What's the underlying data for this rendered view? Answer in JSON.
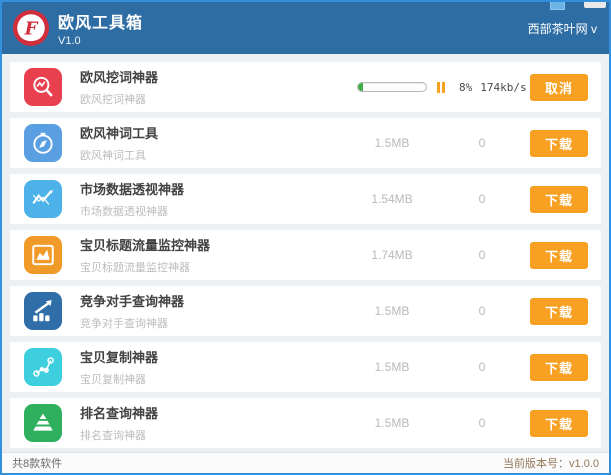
{
  "header": {
    "title": "欧风工具箱",
    "version": "V1.0",
    "right_text": "西部茶叶网 v"
  },
  "rows": [
    {
      "icon": "keyword-mining-icon",
      "icon_color": "#e8404e",
      "title": "欧风挖词神器",
      "subtitle": "欧风挖词神器",
      "state": "downloading",
      "progress": 8,
      "progress_label": "8%",
      "speed": "174kb/s",
      "button_label": "取消"
    },
    {
      "icon": "compass-icon",
      "icon_color": "#5b9fe3",
      "title": "欧风神词工具",
      "subtitle": "欧风神词工具",
      "state": "idle",
      "size": "1.5MB",
      "count": "0",
      "button_label": "下载"
    },
    {
      "icon": "line-chart-icon",
      "icon_color": "#4cb2e9",
      "title": "市场数据透视神器",
      "subtitle": "市场数据透视神器",
      "state": "idle",
      "size": "1.54MB",
      "count": "0",
      "button_label": "下载"
    },
    {
      "icon": "chart-box-icon",
      "icon_color": "#f09b28",
      "title": "宝贝标题流量监控神器",
      "subtitle": "宝贝标题流量监控神器",
      "state": "idle",
      "size": "1.74MB",
      "count": "0",
      "button_label": "下载"
    },
    {
      "icon": "trend-coins-icon",
      "icon_color": "#2f6ea8",
      "title": "竞争对手查询神器",
      "subtitle": "竞争对手查询神器",
      "state": "idle",
      "size": "1.5MB",
      "count": "0",
      "button_label": "下载"
    },
    {
      "icon": "nodes-icon",
      "icon_color": "#3ecfdf",
      "title": "宝贝复制神器",
      "subtitle": "宝贝复制神器",
      "state": "idle",
      "size": "1.5MB",
      "count": "0",
      "button_label": "下载"
    },
    {
      "icon": "pyramid-icon",
      "icon_color": "#2fb05e",
      "title": "排名查询神器",
      "subtitle": "排名查询神器",
      "state": "idle",
      "size": "1.5MB",
      "count": "0",
      "button_label": "下载"
    }
  ],
  "footer": {
    "left": "共8款软件",
    "right": "当前版本号：v1.0.0"
  },
  "colors": {
    "accent_orange": "#f7a021",
    "progress_green": "#3fae49",
    "header_blue": "#2d6da4",
    "border_blue": "#3390dd"
  }
}
